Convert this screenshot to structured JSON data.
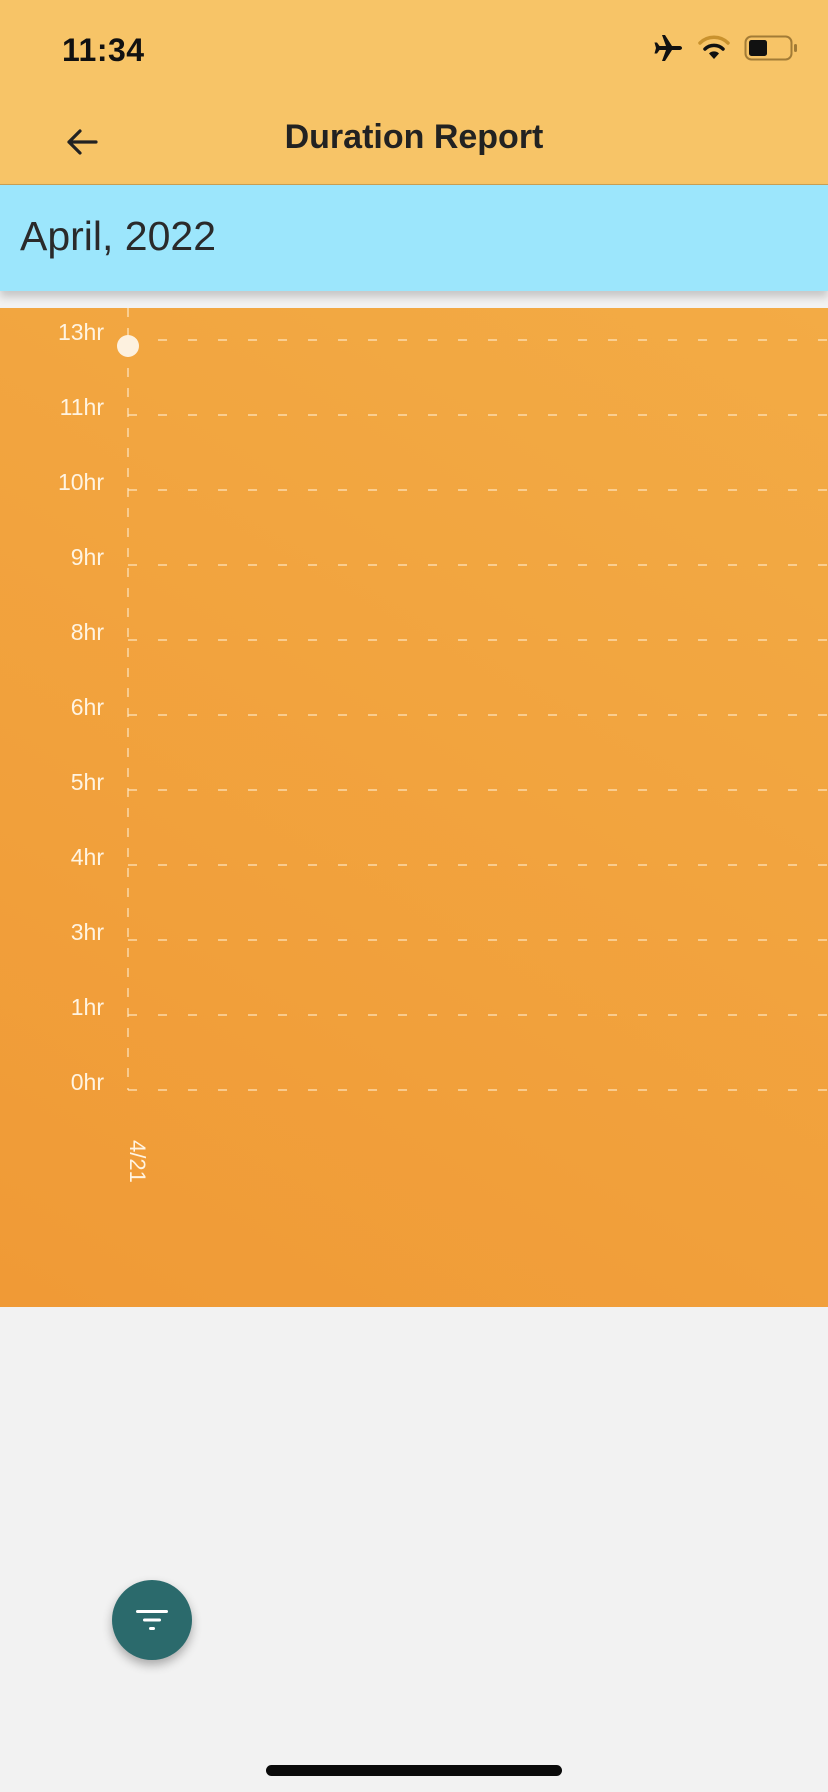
{
  "status_bar": {
    "time": "11:34",
    "icons": [
      "airplane-mode-icon",
      "wifi-icon",
      "battery-icon"
    ]
  },
  "app_bar": {
    "title": "Duration Report",
    "back_icon": "arrow-left-icon"
  },
  "month_header": {
    "label": "April, 2022"
  },
  "colors": {
    "app_bar": "#f7c467",
    "month_header": "#9ce6fc",
    "chart_background": "#f2a13e",
    "fab": "#2b6a6c",
    "page_background": "#f2f2f2"
  },
  "chart_data": {
    "type": "scatter",
    "y_tick_labels": [
      "13hr",
      "11hr",
      "10hr",
      "9hr",
      "8hr",
      "6hr",
      "5hr",
      "4hr",
      "3hr",
      "1hr",
      "0hr"
    ],
    "x_tick_labels": [
      "4/21"
    ],
    "ylim": [
      0,
      13
    ],
    "grid": true,
    "series": [
      {
        "points": [
          {
            "x": "4/21",
            "y": 13
          }
        ]
      }
    ]
  },
  "fab": {
    "icon": "filter-icon"
  }
}
